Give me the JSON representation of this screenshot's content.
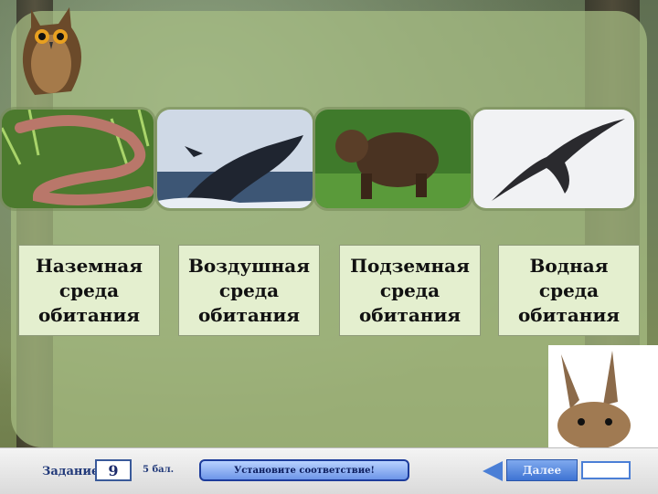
{
  "cards": [
    {
      "line1": "Наземная",
      "line2": "среда",
      "line3": "обитания"
    },
    {
      "line1": "Воздушная",
      "line2": "среда",
      "line3": "обитания"
    },
    {
      "line1": "Подземная",
      "line2": "среда",
      "line3": "обитания"
    },
    {
      "line1": "Водная",
      "line2": "среда",
      "line3": "обитания"
    }
  ],
  "photos": [
    "earthworm",
    "whale",
    "bear",
    "swift"
  ],
  "footer": {
    "task_label": "Задание",
    "task_number": "9",
    "points": "5 бал.",
    "instruction": "Установите соответствие!",
    "next_label": "Далее"
  }
}
